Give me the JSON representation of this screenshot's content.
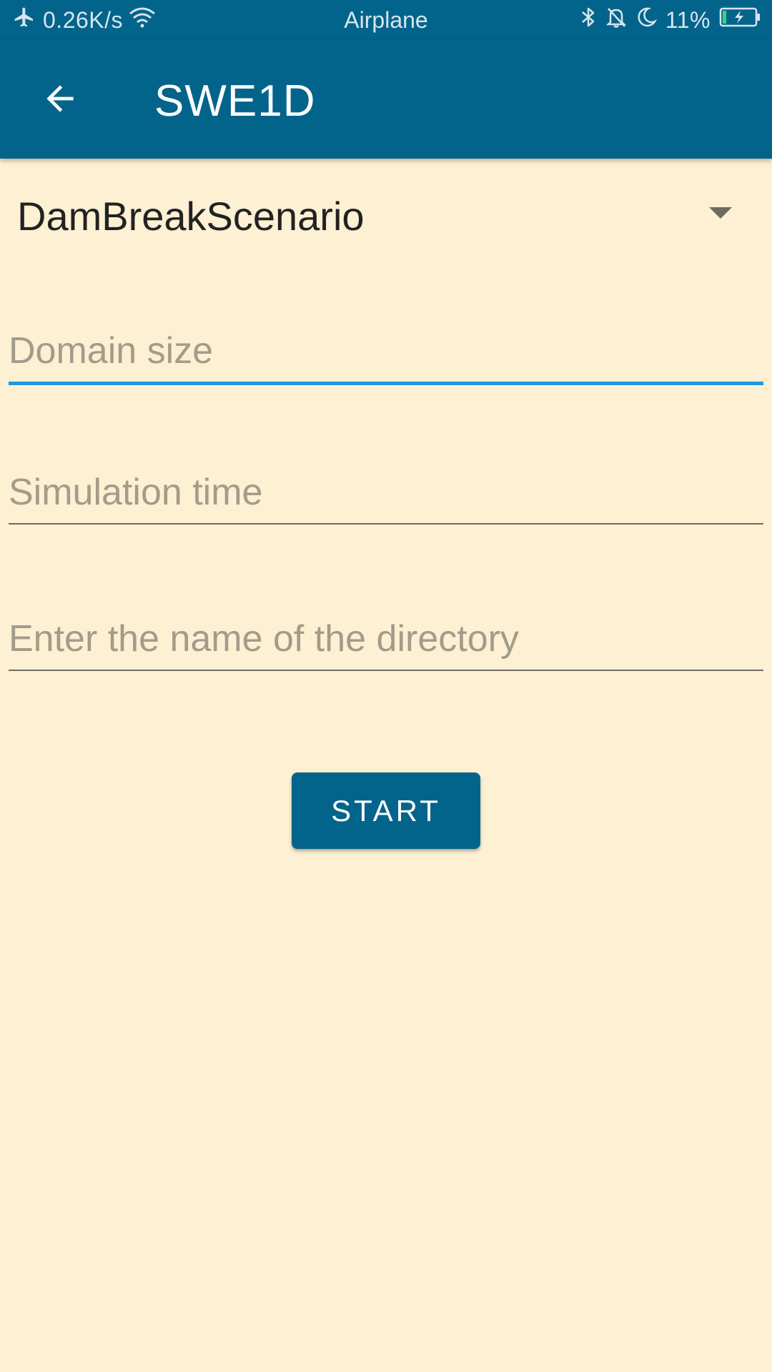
{
  "status_bar": {
    "network_speed": "0.26K/s",
    "mode": "Airplane",
    "battery": "11%",
    "icons": [
      "airplane-icon",
      "wifi-icon",
      "bluetooth-icon",
      "bell-off-icon",
      "moon-icon",
      "battery-charging-icon"
    ]
  },
  "app_bar": {
    "title": "SWE1D",
    "back_icon": "arrow-back-icon"
  },
  "spinner": {
    "selected": "DamBreakScenario",
    "icon": "dropdown-arrow-icon"
  },
  "fields": {
    "domain_size": {
      "placeholder": "Domain size",
      "value": ""
    },
    "simulation_time": {
      "placeholder": "Simulation time",
      "value": ""
    },
    "directory": {
      "placeholder": "Enter the name of the directory",
      "value": ""
    }
  },
  "actions": {
    "start_label": "START"
  },
  "colors": {
    "primary": "#02638B",
    "background": "#FDF0D3",
    "focus": "#2196E3",
    "hint": "#A39C8B"
  }
}
